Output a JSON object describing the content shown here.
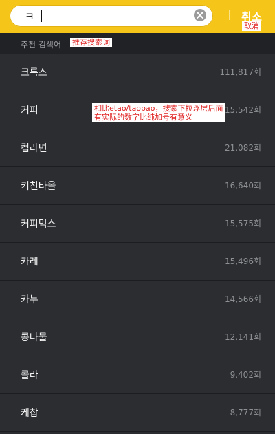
{
  "search": {
    "value": "ㅋ",
    "placeholder": ""
  },
  "header": {
    "cancel_label": "취소",
    "cancel_note": "取消"
  },
  "section": {
    "title": "추천 검색어",
    "note": "推荐搜索词"
  },
  "annotation": {
    "text": "相比etao/taobao，搜索下拉浮层后面\n有实际的数字比纯加号有意义"
  },
  "suggestions": [
    {
      "term": "크록스",
      "count": "111,817회"
    },
    {
      "term": "커피",
      "count": "115,542회"
    },
    {
      "term": "컵라면",
      "count": "21,082회"
    },
    {
      "term": "키친타올",
      "count": "16,640회"
    },
    {
      "term": "커피믹스",
      "count": "15,575회"
    },
    {
      "term": "카레",
      "count": "15,496회"
    },
    {
      "term": "카누",
      "count": "14,566회"
    },
    {
      "term": "콩나물",
      "count": "12,141회"
    },
    {
      "term": "콜라",
      "count": "9,402회"
    },
    {
      "term": "케찹",
      "count": "8,777회"
    }
  ],
  "colors": {
    "accent": "#f6c51a",
    "background": "#2a2c2f",
    "annotation_text": "#e02020"
  },
  "icons": {
    "clear": "clear-icon"
  }
}
